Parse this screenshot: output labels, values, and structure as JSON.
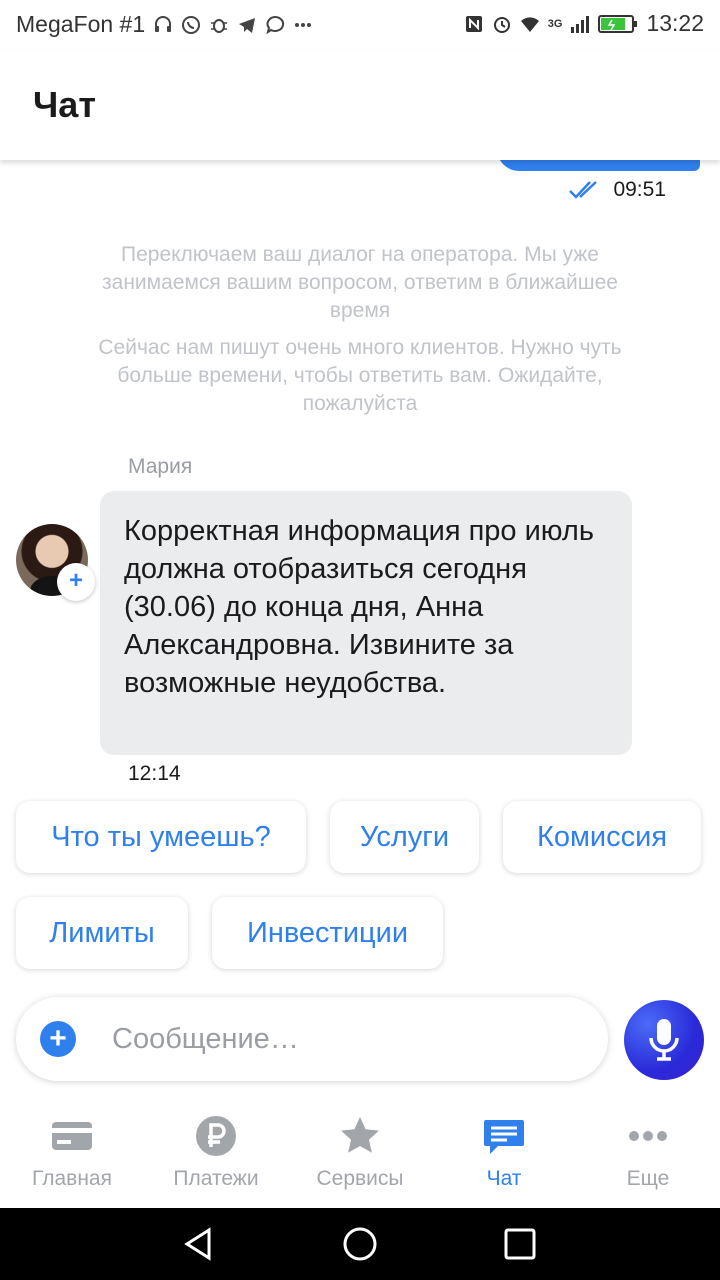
{
  "status_bar": {
    "carrier": "MegaFon #1",
    "network": "3G",
    "time": "13:22"
  },
  "header": {
    "title": "Чат"
  },
  "chat": {
    "outgoing_time": "09:51",
    "system_messages": [
      "Переключаем ваш диалог на оператора. Мы уже занимаемся вашим вопросом, ответим в ближайшее время",
      "Сейчас нам пишут очень много клиентов. Нужно чуть больше времени, чтобы ответить вам. Ожидайте, пожалуйста"
    ],
    "incoming": {
      "sender": "Мария",
      "text": "Корректная информация про июль должна отобразиться сегодня (30.06) до конца дня, Анна Александровна. Извините за возможные неудобства.",
      "time": "12:14"
    }
  },
  "quick_replies": [
    "Что ты умеешь?",
    "Услуги",
    "Комиссия",
    "Лимиты",
    "Инвестиции"
  ],
  "composer": {
    "placeholder": "Сообщение…"
  },
  "tabs": [
    {
      "label": "Главная",
      "icon": "card-icon"
    },
    {
      "label": "Платежи",
      "icon": "ruble-icon"
    },
    {
      "label": "Сервисы",
      "icon": "star-icon"
    },
    {
      "label": "Чат",
      "icon": "chat-icon",
      "active": true
    },
    {
      "label": "Еще",
      "icon": "more-icon"
    }
  ],
  "colors": {
    "accent": "#2f80ed",
    "bubble_in": "#ebecee",
    "system_text": "#c0c4c9",
    "tab_inactive": "#a2a6ab"
  }
}
